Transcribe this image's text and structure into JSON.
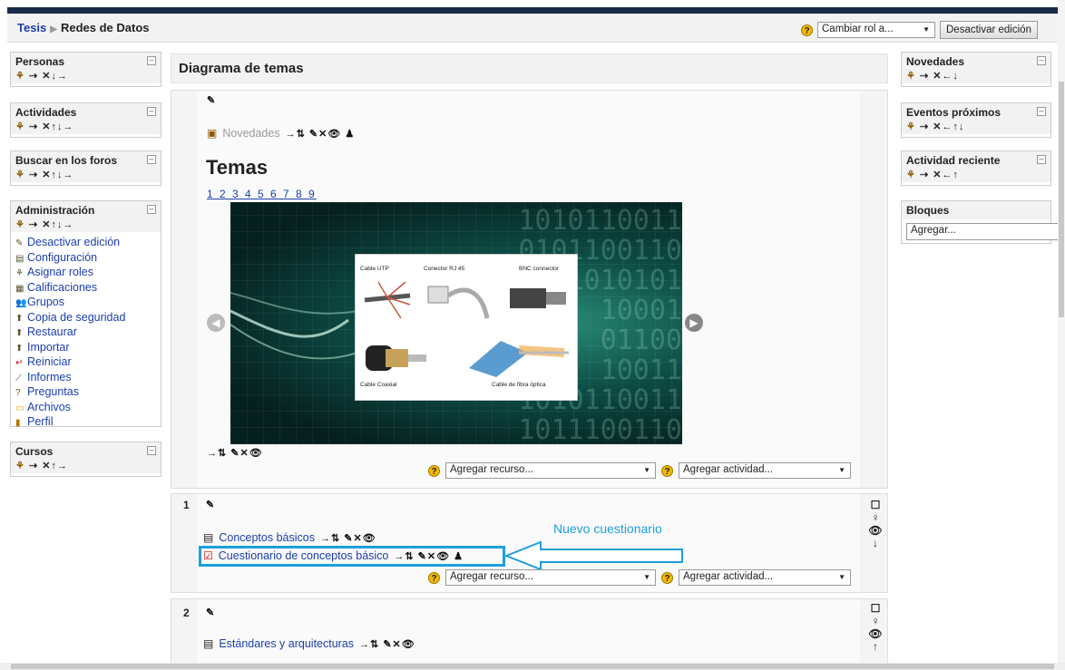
{
  "breadcrumb": {
    "root": "Tesis",
    "current": "Redes de Datos"
  },
  "header": {
    "role_select": "Cambiar rol a...",
    "edit_button": "Desactivar edición"
  },
  "left_blocks": {
    "personas": {
      "title": "Personas",
      "icons": "⇢ ✕↓→"
    },
    "actividades": {
      "title": "Actividades",
      "icons": "⇢ ✕↑↓→"
    },
    "buscar": {
      "title": "Buscar en los foros",
      "icons": "⇢ ✕↑↓→"
    },
    "admin": {
      "title": "Administración",
      "icons": "⇢ ✕↑↓→",
      "items": [
        "Desactivar edición",
        "Configuración",
        "Asignar roles",
        "Calificaciones",
        "Grupos",
        "Copia de seguridad",
        "Restaurar",
        "Importar",
        "Reiniciar",
        "Informes",
        "Preguntas",
        "Archivos",
        "Perfil"
      ]
    },
    "cursos": {
      "title": "Cursos",
      "icons": "⇢ ✕↑→"
    }
  },
  "right_blocks": {
    "novedades": {
      "title": "Novedades",
      "icons": "⇢ ✕←↓"
    },
    "eventos": {
      "title": "Eventos próximos",
      "icons": "⇢ ✕←↑↓"
    },
    "actividad": {
      "title": "Actividad reciente",
      "icons": "⇢ ✕←↑"
    },
    "bloques": {
      "title": "Bloques",
      "select": "Agregar..."
    }
  },
  "main": {
    "heading": "Diagrama de temas",
    "section0": {
      "news_link": "Novedades",
      "title": "Temas",
      "pager": "1 2 3 4 5 6 7 8 9",
      "binary_lines": [
        "1010110011",
        "0101100110",
        "1010101",
        "10001",
        "01100",
        "10011",
        "1010110011",
        "1011100110"
      ],
      "card_labels": {
        "utp": "Cable UTP",
        "rj45": "Conector RJ 45",
        "bnc": "BNC connector",
        "coax": "Cable Coaxial",
        "fiber": "Cable de fibra óptica"
      }
    },
    "add_resource": "Agregar recurso...",
    "add_activity": "Agregar actividad...",
    "section1": {
      "number": "1",
      "items": [
        "Conceptos básicos",
        "Cuestionario de conceptos básico"
      ]
    },
    "callout": "Nuevo cuestionario",
    "section2": {
      "number": "2",
      "items": [
        "Estándares y arquitecturas"
      ]
    }
  },
  "controls": {
    "edit_icons": "→⇅ ✎✕👁",
    "edit_icons_extra": "→⇅ ✎✕👁 ♟"
  }
}
